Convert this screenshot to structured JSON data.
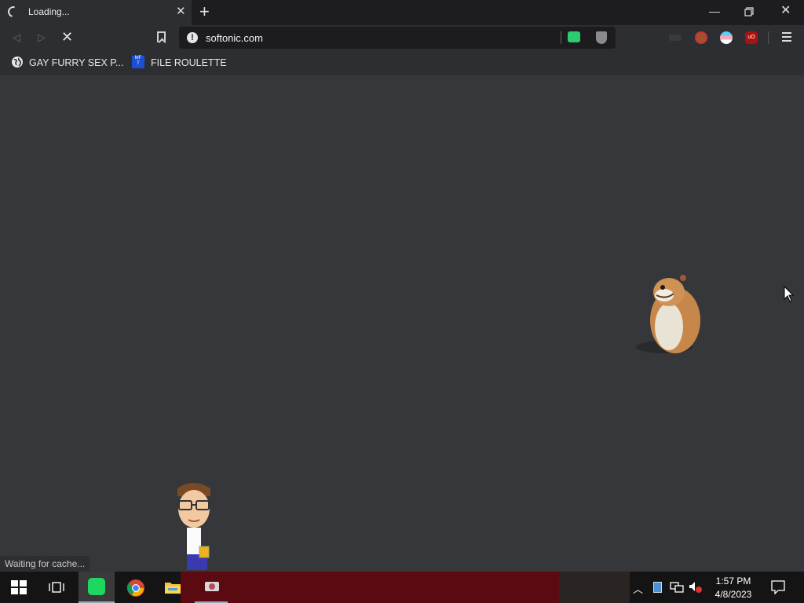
{
  "tab": {
    "title": "Loading..."
  },
  "address": {
    "url": "softonic.com"
  },
  "bookmarks": [
    {
      "label": "GAY FURRY SEX P..."
    },
    {
      "label": "FILE ROULETTE",
      "icon_text": "MF\nT"
    }
  ],
  "status": {
    "text": "Waiting for cache..."
  },
  "taskbar": {
    "time": "1:57 PM",
    "date": "4/8/2023"
  },
  "colors": {
    "tabbar": "#1d1d1f",
    "toolbar": "#2d2e31",
    "page": "#36373b",
    "taskbar_wallpaper": "#5a0a10",
    "spotify_green": "#1ed760"
  }
}
